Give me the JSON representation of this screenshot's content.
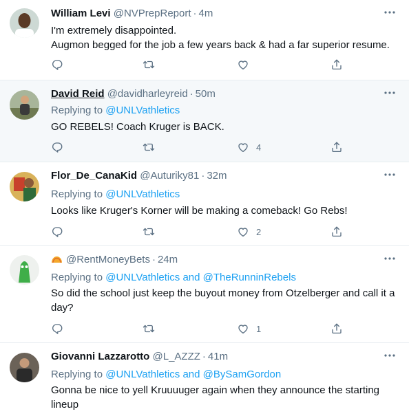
{
  "tweets": [
    {
      "name": "William Levi",
      "handle": "@NVPrepReport",
      "time": "4m",
      "body": [
        "I'm extremely disappointed.",
        "Augmon begged for the job a few years back & had a far superior resume."
      ],
      "like_count": ""
    },
    {
      "name": "David Reid",
      "handle": "@davidharleyreid",
      "time": "50m",
      "replying_label": "Replying to",
      "replying_to": "@UNLVathletics",
      "body": [
        "GO REBELS! Coach Kruger is BACK."
      ],
      "like_count": "4"
    },
    {
      "name": "Flor_De_CanaKid",
      "handle": "@Auturiky81",
      "time": "32m",
      "replying_label": "Replying to",
      "replying_to": "@UNLVathletics",
      "body": [
        "Looks like Kruger's Korner will be making a comeback! Go Rebs!"
      ],
      "like_count": "2"
    },
    {
      "name": "",
      "handle": "@RentMoneyBets",
      "time": "24m",
      "replying_label": "Replying to",
      "replying_to": "@UNLVathletics",
      "replying_and": "and",
      "replying_to_2": "@TheRunninRebels",
      "body": [
        "So did the school just keep the buyout money from Otzelberger and call it a",
        "day?"
      ],
      "like_count": "1"
    },
    {
      "name": "Giovanni Lazzarotto",
      "handle": "@L_AZZZ",
      "time": "41m",
      "replying_label": "Replying to",
      "replying_to": "@UNLVathletics",
      "replying_and": "and",
      "replying_to_2": "@BySamGordon",
      "body": [
        "Gonna be nice to yell Kruuuuger again when they announce the starting",
        "lineup"
      ],
      "like_count": ""
    }
  ],
  "dot": "·",
  "icons": [
    "reply-icon",
    "retweet-icon",
    "like-icon",
    "share-icon",
    "more-icon"
  ],
  "colors": {
    "link": "#1da1f2",
    "muted": "#5b7083",
    "text": "#0f1419",
    "highlight": "#f5f8fa",
    "divider": "#e6ecf0"
  }
}
